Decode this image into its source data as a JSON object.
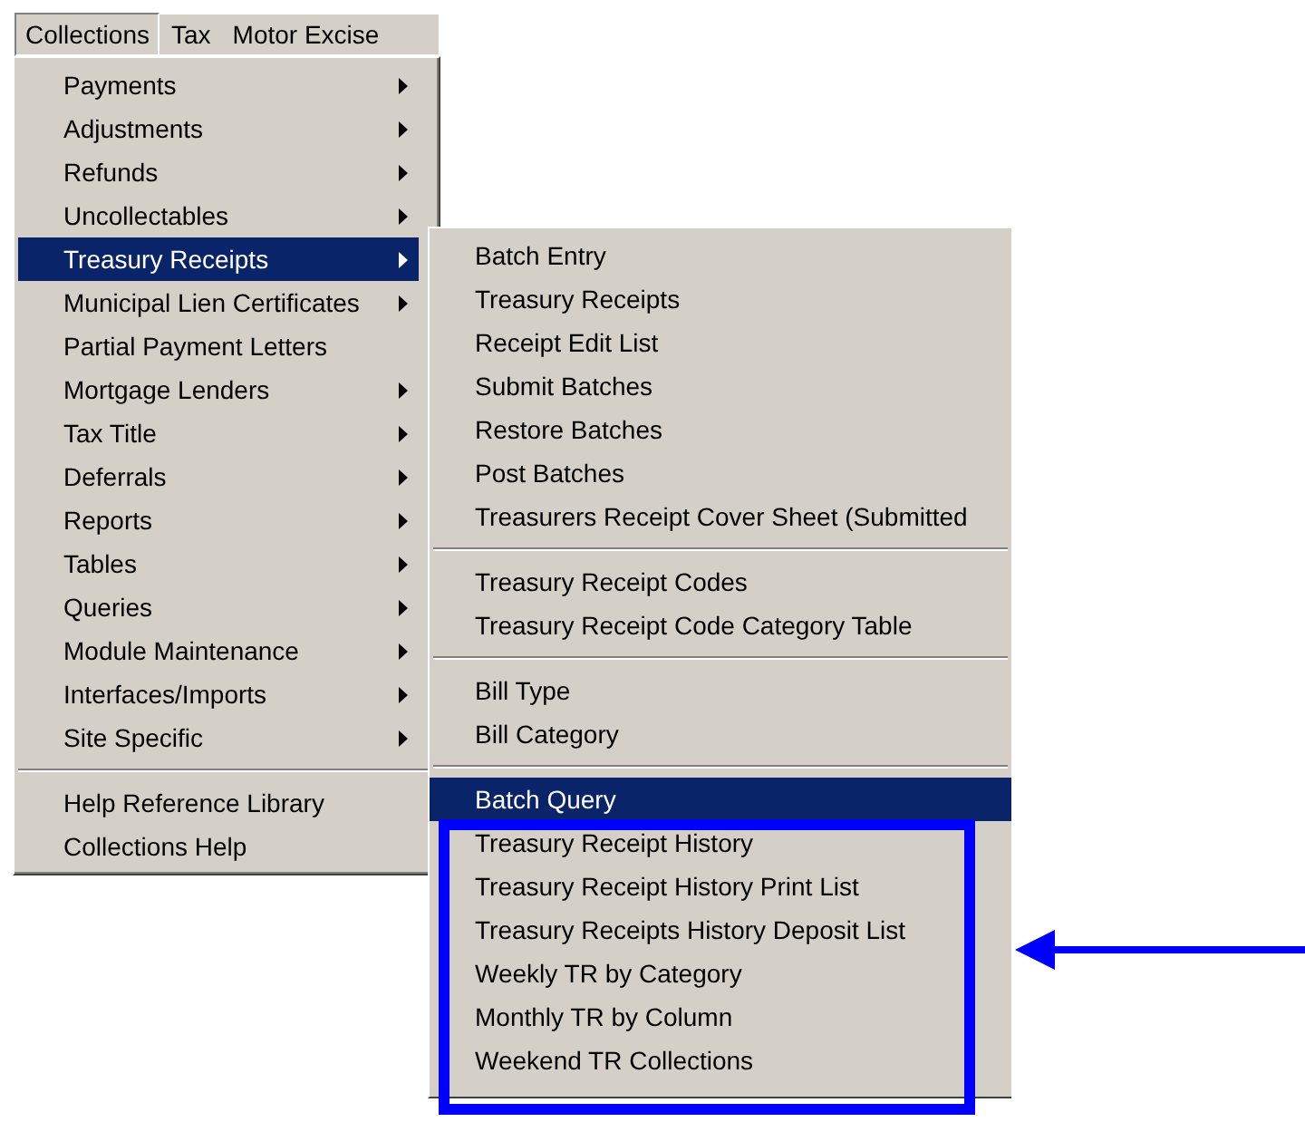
{
  "menubar": [
    {
      "label": "Collections",
      "selected": true
    },
    {
      "label": "Tax",
      "selected": false
    },
    {
      "label": "Motor Excise",
      "selected": false
    }
  ],
  "menu": [
    {
      "kind": "item",
      "label": "Payments",
      "submenu": true,
      "selected": false
    },
    {
      "kind": "item",
      "label": "Adjustments",
      "submenu": true,
      "selected": false
    },
    {
      "kind": "item",
      "label": "Refunds",
      "submenu": true,
      "selected": false
    },
    {
      "kind": "item",
      "label": "Uncollectables",
      "submenu": true,
      "selected": false
    },
    {
      "kind": "item",
      "label": "Treasury Receipts",
      "submenu": true,
      "selected": true
    },
    {
      "kind": "item",
      "label": "Municipal Lien Certificates",
      "submenu": true,
      "selected": false
    },
    {
      "kind": "item",
      "label": "Partial Payment Letters",
      "submenu": false,
      "selected": false
    },
    {
      "kind": "item",
      "label": "Mortgage Lenders",
      "submenu": true,
      "selected": false
    },
    {
      "kind": "item",
      "label": "Tax Title",
      "submenu": true,
      "selected": false
    },
    {
      "kind": "item",
      "label": "Deferrals",
      "submenu": true,
      "selected": false
    },
    {
      "kind": "item",
      "label": "Reports",
      "submenu": true,
      "selected": false
    },
    {
      "kind": "item",
      "label": "Tables",
      "submenu": true,
      "selected": false
    },
    {
      "kind": "item",
      "label": "Queries",
      "submenu": true,
      "selected": false
    },
    {
      "kind": "item",
      "label": "Module Maintenance",
      "submenu": true,
      "selected": false
    },
    {
      "kind": "item",
      "label": "Interfaces/Imports",
      "submenu": true,
      "selected": false
    },
    {
      "kind": "item",
      "label": "Site Specific",
      "submenu": true,
      "selected": false
    },
    {
      "kind": "separator"
    },
    {
      "kind": "item",
      "label": "Help Reference Library",
      "submenu": false,
      "selected": false
    },
    {
      "kind": "item",
      "label": "Collections Help",
      "submenu": false,
      "selected": false
    }
  ],
  "submenu": [
    {
      "kind": "item",
      "label": "Batch Entry",
      "selected": false
    },
    {
      "kind": "item",
      "label": "Treasury Receipts",
      "selected": false
    },
    {
      "kind": "item",
      "label": "Receipt Edit List",
      "selected": false
    },
    {
      "kind": "item",
      "label": "Submit Batches",
      "selected": false
    },
    {
      "kind": "item",
      "label": "Restore Batches",
      "selected": false
    },
    {
      "kind": "item",
      "label": "Post Batches",
      "selected": false
    },
    {
      "kind": "item",
      "label": "Treasurers Receipt Cover Sheet (Submitted",
      "selected": false
    },
    {
      "kind": "separator"
    },
    {
      "kind": "item",
      "label": "Treasury Receipt Codes",
      "selected": false
    },
    {
      "kind": "item",
      "label": "Treasury Receipt Code Category Table",
      "selected": false
    },
    {
      "kind": "separator"
    },
    {
      "kind": "item",
      "label": "Bill Type",
      "selected": false
    },
    {
      "kind": "item",
      "label": "Bill Category",
      "selected": false
    },
    {
      "kind": "separator"
    },
    {
      "kind": "item",
      "label": "Batch Query",
      "selected": true
    },
    {
      "kind": "item",
      "label": "Treasury Receipt History",
      "selected": false
    },
    {
      "kind": "item",
      "label": "Treasury Receipt History Print List",
      "selected": false
    },
    {
      "kind": "item",
      "label": "Treasury Receipts History Deposit List",
      "selected": false
    },
    {
      "kind": "item",
      "label": "Weekly TR by Category",
      "selected": false
    },
    {
      "kind": "item",
      "label": "Monthly TR by Column",
      "selected": false
    },
    {
      "kind": "item",
      "label": "Weekend TR Collections",
      "selected": false
    }
  ]
}
